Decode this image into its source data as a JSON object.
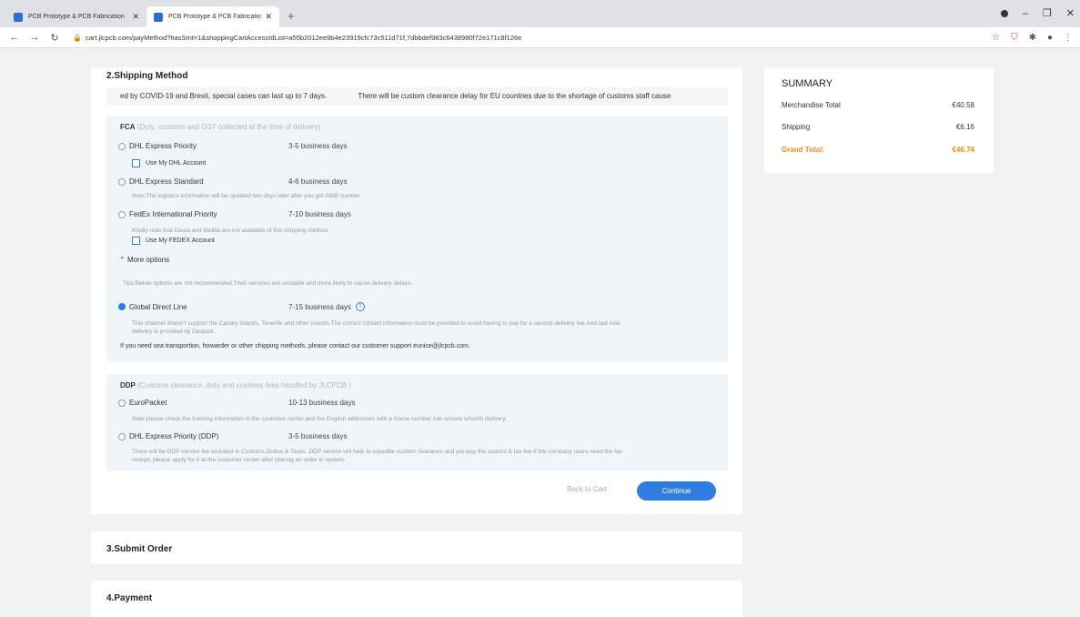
{
  "browser": {
    "tabs": [
      {
        "title": "PCB Prototype & PCB Fabrication",
        "active": false
      },
      {
        "title": "PCB Prototype & PCB Fabrication",
        "active": true
      }
    ],
    "url": "cart.jlcpcb.com/payMethod?hasSmt=1&shoppingCartAccessIdList=a55b2012ee9b4e23919cfc73c511d71f,7dbbdef983c6438980f72e171c8f126e"
  },
  "shipping": {
    "title": "2.Shipping Method",
    "notice": [
      "ed by COVID-19 and Brexit, special cases can last up to 7 days.",
      "There will be custom clearance delay for EU countries due to the shortage of customs staff cause"
    ],
    "fca": {
      "label": "FCA",
      "sub": "(Duty, customs and GST collected at the time of delivery)",
      "options": [
        {
          "name": "DHL Express Priority",
          "days": "3-5 business days"
        },
        {
          "name": "DHL Express Standard",
          "days": "4-6 business days"
        },
        {
          "name": "FedEx International Priority",
          "days": "7-10 business days"
        },
        {
          "name": "Global Direct Line",
          "days": "7-15 business days"
        }
      ],
      "use_dhl": "Use My DHL Account",
      "dhl_std_note": "Note:The logistics information will be updated two days later after you get AWB number.",
      "fedex_note": "Kindly note that Ceuta and Melilla are not available of this shipping method",
      "use_fedex": "Use My FEDEX Account",
      "more_options": "More options",
      "tips": "Tips:Below options are not recommended.Their services are unstable and more likely to cause delivery delays.",
      "gdl_note_1": "This channel doesn't support the Canary Islands, Tenerife and other islands.The correct contact information must be provided to avoid having to pay for a second delivery fee.And last mile",
      "gdl_note_2": "delivery is provided by Daopick.",
      "contact": "If you need sea transportion, forwarder or other shipping methods, please contact our customer support eunice@jlcpcb.com."
    },
    "ddp": {
      "label": "DDP",
      "sub": "(Customs clearance, duty and customs fees handled by JLCPCB.)",
      "options": [
        {
          "name": "EuroPacket",
          "days": "10-13 business days"
        },
        {
          "name": "DHL Express Priority (DDP)",
          "days": "3-5 business days"
        }
      ],
      "euro_note": "Note:please check the tracking information in the customer center,and the English addresses with a house number can ensure smooth delivery.",
      "dhl_ddp_note_1": "There will be DDP service fee included in Customs Duties & Taxes. DDP service will help to expedite custom clearance and pre-pay the custom & tax fee.If the company users need the tax",
      "dhl_ddp_note_2": "receipt, please apply for it at the customer center after placing an order in system."
    },
    "back": "Back to Cart",
    "continue": "Continue"
  },
  "steps": {
    "submit": "3.Submit Order",
    "payment": "4.Payment"
  },
  "summary": {
    "title": "SUMMARY",
    "merch_label": "Merchandise Total",
    "merch_value": "€40.58",
    "ship_label": "Shipping",
    "ship_value": "€6.16",
    "grand_label": "Grand Total:",
    "grand_value": "€46.74"
  },
  "colors": {
    "accent": "#2f7de1",
    "grand_total": "#f08b18"
  }
}
